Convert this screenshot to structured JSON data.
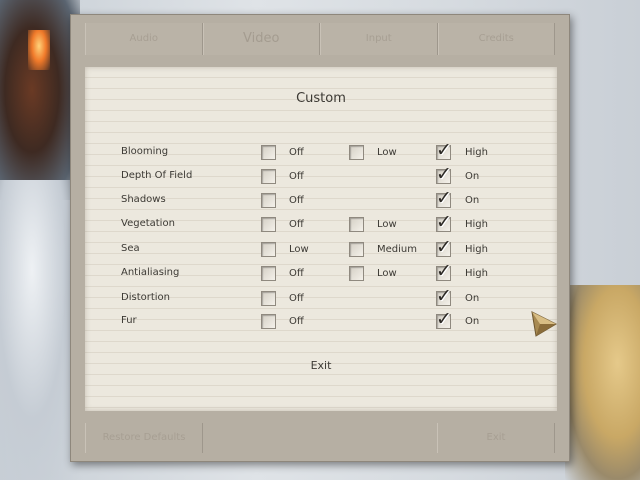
{
  "tabs": [
    "Audio",
    "Video",
    "Input",
    "Credits"
  ],
  "active_tab": 1,
  "section_title": "Custom",
  "options": [
    {
      "label": "Blooming",
      "choices": [
        {
          "label": "Off",
          "checked": false
        },
        {
          "label": "Low",
          "checked": false
        },
        {
          "label": "High",
          "checked": true
        }
      ]
    },
    {
      "label": "Depth Of Field",
      "choices": [
        {
          "label": "Off",
          "checked": false
        },
        null,
        {
          "label": "On",
          "checked": true
        }
      ]
    },
    {
      "label": "Shadows",
      "choices": [
        {
          "label": "Off",
          "checked": false
        },
        null,
        {
          "label": "On",
          "checked": true
        }
      ]
    },
    {
      "label": "Vegetation",
      "choices": [
        {
          "label": "Off",
          "checked": false
        },
        {
          "label": "Low",
          "checked": false
        },
        {
          "label": "High",
          "checked": true
        }
      ]
    },
    {
      "label": "Sea",
      "choices": [
        {
          "label": "Low",
          "checked": false
        },
        {
          "label": "Medium",
          "checked": false
        },
        {
          "label": "High",
          "checked": true
        }
      ]
    },
    {
      "label": "Antialiasing",
      "choices": [
        {
          "label": "Off",
          "checked": false
        },
        {
          "label": "Low",
          "checked": false
        },
        {
          "label": "High",
          "checked": true
        }
      ]
    },
    {
      "label": "Distortion",
      "choices": [
        {
          "label": "Off",
          "checked": false
        },
        null,
        {
          "label": "On",
          "checked": true
        }
      ]
    },
    {
      "label": "Fur",
      "choices": [
        {
          "label": "Off",
          "checked": false
        },
        null,
        {
          "label": "On",
          "checked": true
        }
      ]
    }
  ],
  "exit_label": "Exit",
  "bottom": {
    "restore_label": "Restore Defaults",
    "exit_label": "Exit"
  },
  "colors": {
    "frame": "#b6afa3",
    "paper": "#ece8de",
    "text": "#3c3934"
  },
  "icons": {
    "check": "check-mark-icon",
    "next": "arrow-right-icon"
  }
}
